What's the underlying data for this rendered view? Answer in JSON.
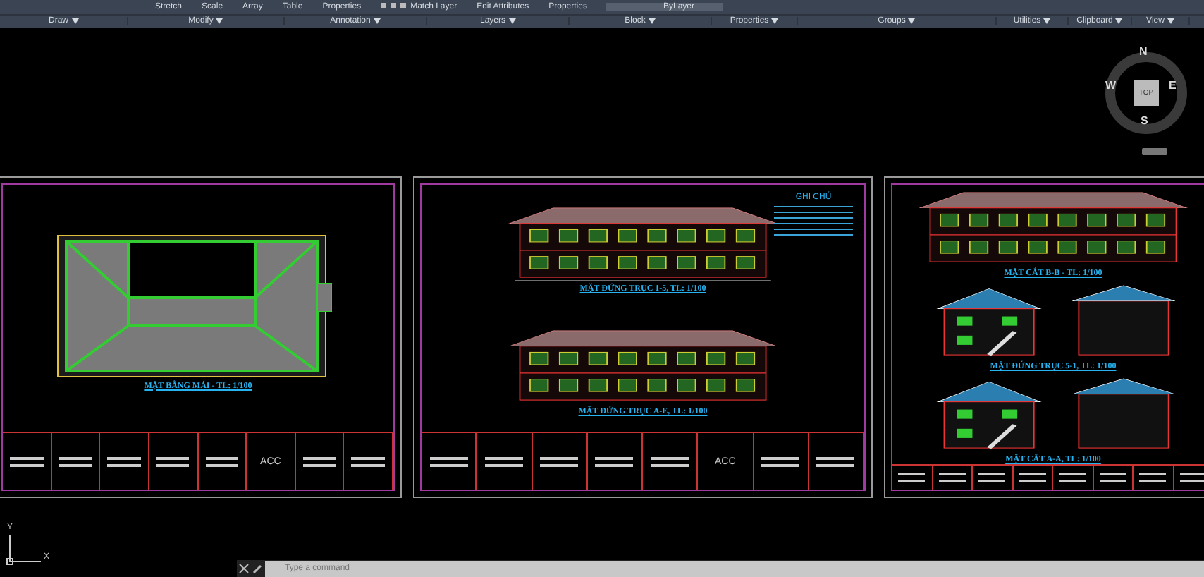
{
  "ribbon": {
    "tools": [
      {
        "kind": "text",
        "label": "Stretch"
      },
      {
        "kind": "text",
        "label": "Scale"
      },
      {
        "kind": "text",
        "label": "Array"
      },
      {
        "kind": "text",
        "label": "Table"
      },
      {
        "kind": "text",
        "label": "Properties"
      },
      {
        "kind": "layers",
        "label": "Match Layer"
      },
      {
        "kind": "text",
        "label": "Edit Attributes"
      },
      {
        "kind": "text",
        "label": "Properties"
      },
      {
        "kind": "dropdown",
        "label": "ByLayer"
      }
    ],
    "panels": [
      "Draw",
      "Modify",
      "Annotation",
      "Layers",
      "Block",
      "Properties",
      "Groups",
      "Utilities",
      "Clipboard",
      "View"
    ]
  },
  "sheets": [
    {
      "views": [
        {
          "kind": "roof-plan",
          "title": "MẶT BẰNG MÁI - TL: 1/100"
        }
      ],
      "block_label": "ACC"
    },
    {
      "views": [
        {
          "kind": "elevation",
          "title": "MẶT ĐỨNG TRỤC 1-5, TL: 1/100"
        },
        {
          "kind": "elevation",
          "title": "MẶT ĐỨNG TRỤC A-E, TL: 1/100"
        }
      ],
      "notes_title": "GHI CHÚ",
      "block_label": "ACC"
    },
    {
      "views": [
        {
          "kind": "elevation",
          "title": "MẶT CẮT B-B - TL: 1/100"
        },
        {
          "kind": "section",
          "title": "MẶT ĐỨNG TRỤC 5-1, TL: 1/100"
        },
        {
          "kind": "section",
          "title": "MẶT CẮT A-A, TL: 1/100"
        }
      ]
    }
  ],
  "viewcube": {
    "north": "N",
    "south": "S",
    "east": "E",
    "west": "W",
    "face": "TOP"
  },
  "ucs": {
    "y": "Y",
    "x": "X"
  },
  "command": {
    "placeholder": "Type a command"
  }
}
